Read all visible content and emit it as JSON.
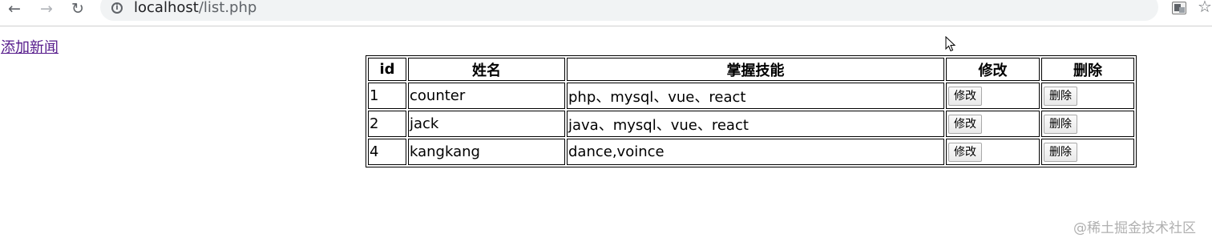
{
  "browser": {
    "url_host": "localhost",
    "url_path": "/list.php"
  },
  "page": {
    "add_link": "添加新闻"
  },
  "table": {
    "headers": {
      "id": "id",
      "name": "姓名",
      "skills": "掌握技能",
      "edit": "修改",
      "delete": "删除"
    },
    "rows": [
      {
        "id": "1",
        "name": "counter",
        "skills": "php、mysql、vue、react",
        "edit_label": "修改",
        "delete_label": "删除"
      },
      {
        "id": "2",
        "name": "jack",
        "skills": "java、mysql、vue、react",
        "edit_label": "修改",
        "delete_label": "删除"
      },
      {
        "id": "4",
        "name": "kangkang",
        "skills": "dance,voince",
        "edit_label": "修改",
        "delete_label": "删除"
      }
    ]
  },
  "watermark": "@稀土掘金技术社区"
}
